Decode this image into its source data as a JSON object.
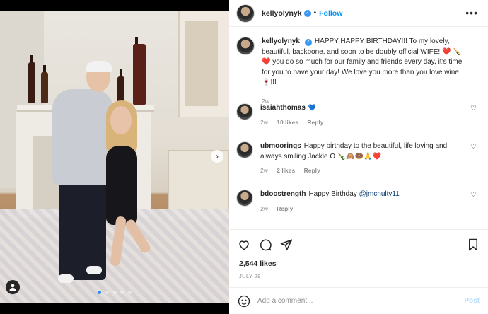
{
  "post": {
    "author": "kellyolynyk",
    "follow_label": "Follow",
    "separator": "•",
    "more_label": "•••",
    "caption": {
      "username": "kellyolynyk",
      "text": "HAPPY HAPPY BIRTHDAY!!! To my lovely, beautiful, backbone, and soon to be doubly official WIFE! ❤️ 🍾 ❤️ you do so much for our family and friends every day, it’s time for you to have your day! We love you more than you love wine 🍷!!!",
      "age": "2w"
    },
    "comments": [
      {
        "username": "isaiahthomas",
        "text": "💙",
        "age": "2w",
        "likes": "10 likes",
        "reply": "Reply"
      },
      {
        "username": "ubmoorings",
        "text": "Happy birthday to the beautiful, life loving and always smiling Jackie O 🍾🙈🍩🙏❤️",
        "age": "2w",
        "likes": "2 likes",
        "reply": "Reply"
      },
      {
        "username": "bdoostrength",
        "text": "Happy Birthday ",
        "mention": "@jmcnulty11",
        "age": "2w",
        "reply": "Reply"
      }
    ],
    "likes_label": "2,544 likes",
    "date_label": "JULY 29",
    "add_comment_placeholder": "Add a comment...",
    "post_button": "Post",
    "carousel": {
      "current_slide": 1,
      "total_slides": 5
    }
  },
  "icons": {
    "verified": "verified-badge-icon",
    "heart": "heart-icon",
    "comment": "comment-icon",
    "share": "share-icon",
    "save": "bookmark-icon",
    "emoji": "emoji-icon",
    "next": "chevron-right-icon",
    "tag": "person-tag-icon"
  },
  "colors": {
    "accent": "#0095f6",
    "verified": "#3897f0",
    "muted": "#8e8e8e"
  }
}
